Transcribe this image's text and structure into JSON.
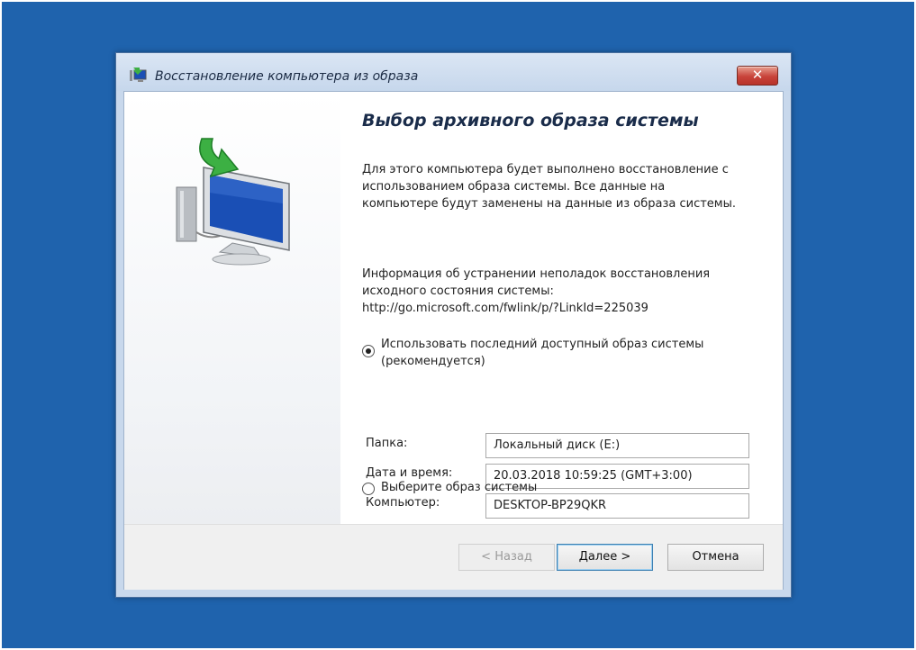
{
  "window": {
    "title": "Восстановление компьютера из образа",
    "close_symbol": "✕"
  },
  "page": {
    "heading": "Выбор архивного образа системы",
    "description": "Для этого компьютера будет выполнено восстановление с использованием образа системы. Все данные на компьютере будут заменены на данные из образа системы.",
    "info_line1": "Информация об устранении неполадок восстановления",
    "info_line2": "исходного состояния системы:",
    "info_link": "http://go.microsoft.com/fwlink/p/?LinkId=225039"
  },
  "options": {
    "latest_label": "Использовать последний доступный образ системы (рекомендуется)",
    "latest_selected": true,
    "choose_label": "Выберите образ системы",
    "choose_selected": false
  },
  "details": [
    {
      "label": "Папка:",
      "value": "Локальный диск (E:)"
    },
    {
      "label": "Дата и время:",
      "value": "20.03.2018 10:59:25 (GMT+3:00)"
    },
    {
      "label": "Компьютер:",
      "value": "DESKTOP-BP29QKR"
    }
  ],
  "buttons": {
    "back": "< Назад",
    "next": "Далее >",
    "cancel": "Отмена"
  },
  "icons": {
    "title_icon": "restore-computer-icon",
    "hero_icon": "computer-restore-arrow-icon"
  },
  "colors": {
    "desktop_background": "#1f63ad",
    "arrow_green": "#3cb043",
    "screen_blue": "#1a4fb5"
  }
}
